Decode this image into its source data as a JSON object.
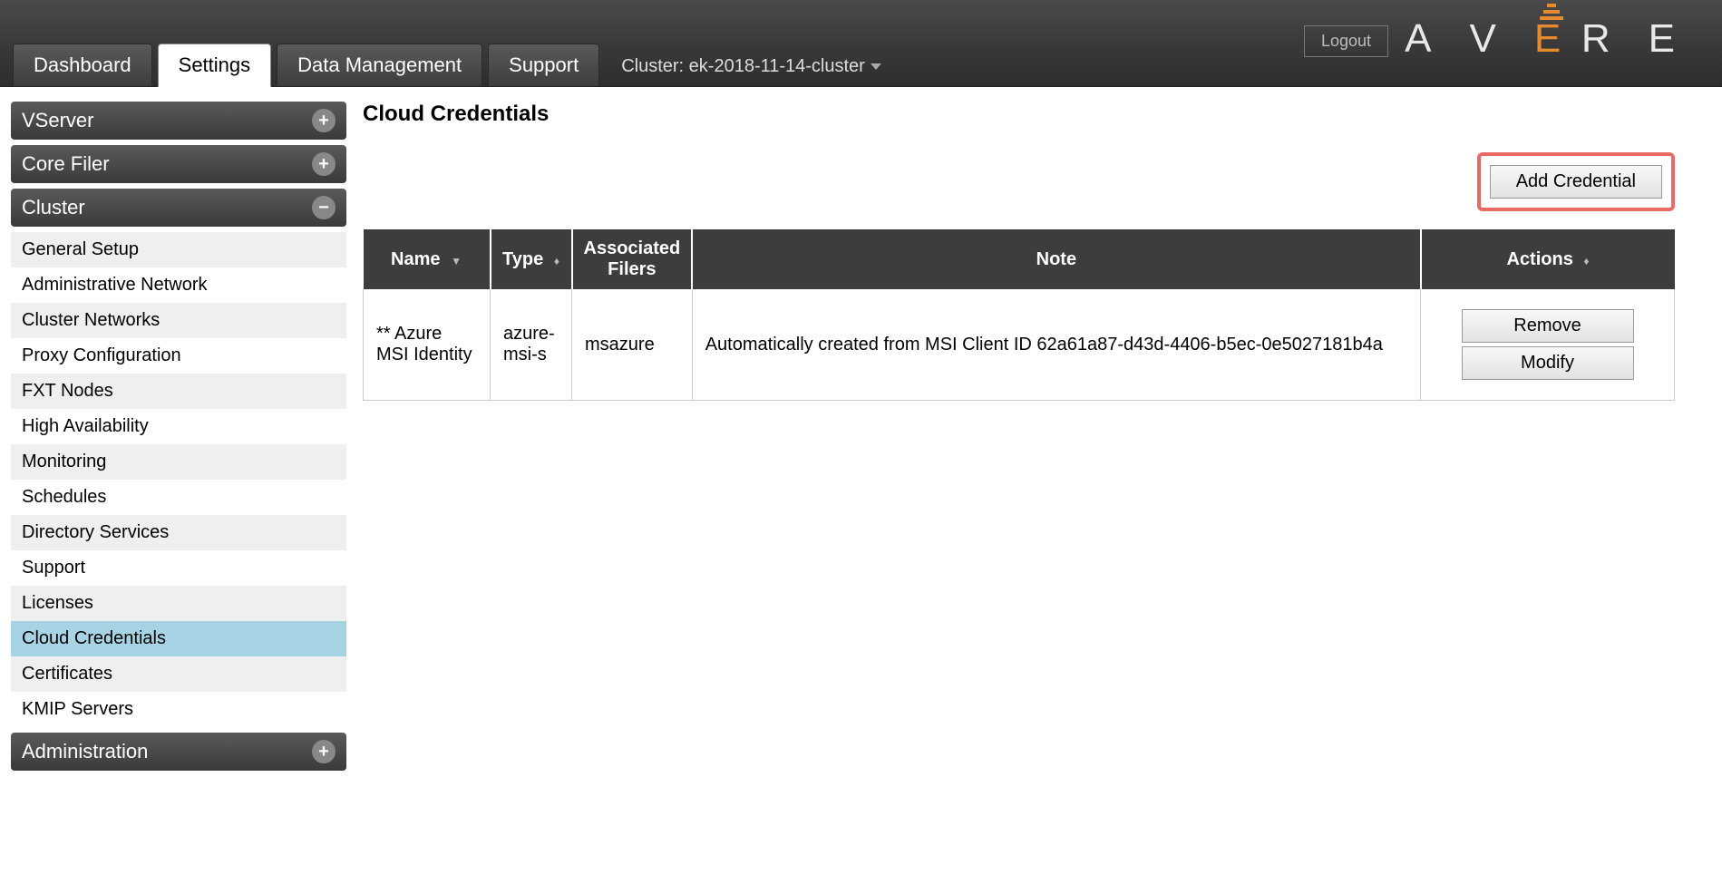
{
  "header": {
    "logout_label": "Logout",
    "brand_letters": [
      "A",
      "V",
      "E",
      "R",
      "E"
    ]
  },
  "tabs": {
    "dashboard": "Dashboard",
    "settings": "Settings",
    "data_management": "Data Management",
    "support": "Support",
    "cluster_label": "Cluster: ek-2018-11-14-cluster"
  },
  "sidebar": {
    "vserver": {
      "label": "VServer"
    },
    "corefiler": {
      "label": "Core Filer"
    },
    "cluster": {
      "label": "Cluster",
      "items": [
        "General Setup",
        "Administrative Network",
        "Cluster Networks",
        "Proxy Configuration",
        "FXT Nodes",
        "High Availability",
        "Monitoring",
        "Schedules",
        "Directory Services",
        "Support",
        "Licenses",
        "Cloud Credentials",
        "Certificates",
        "KMIP Servers"
      ]
    },
    "administration": {
      "label": "Administration"
    }
  },
  "main": {
    "title": "Cloud Credentials",
    "add_button": "Add Credential",
    "columns": {
      "name": "Name",
      "type": "Type",
      "associated_filers": "Associated Filers",
      "note": "Note",
      "actions": "Actions"
    },
    "rows": [
      {
        "name": "** Azure MSI Identity",
        "type": "azure-msi-s",
        "filers": "msazure",
        "note": "Automatically created from MSI Client ID 62a61a87-d43d-4406-b5ec-0e5027181b4a"
      }
    ],
    "actions": {
      "remove": "Remove",
      "modify": "Modify"
    }
  }
}
